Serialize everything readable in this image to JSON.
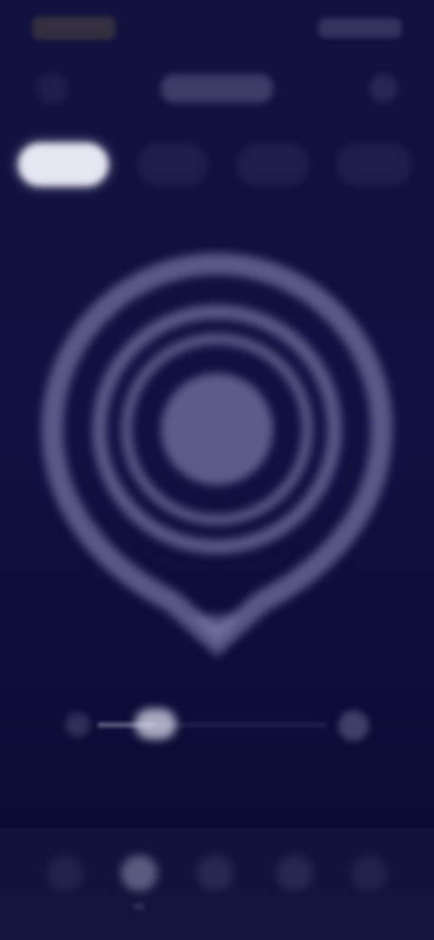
{
  "colors": {
    "background": "#101042",
    "accent": "#e6e6f2",
    "muted": "#8c8cbe"
  },
  "status_bar": {
    "time_icon": "clock-glyph",
    "right_icons": [
      "signal-icon",
      "wifi-icon",
      "battery-icon"
    ]
  },
  "header": {
    "back_icon": "chevron-left-icon",
    "menu_icon": "more-icon"
  },
  "tabs": {
    "active_index": 0,
    "items": [
      {
        "icon": "tab-icon",
        "active": true
      },
      {
        "icon": "tab-icon",
        "active": false
      },
      {
        "icon": "tab-icon",
        "active": false
      },
      {
        "icon": "tab-icon",
        "active": false
      }
    ]
  },
  "hero": {
    "icon": "location-pin-icon",
    "rings": 3
  },
  "slider": {
    "min_icon": "minus-icon",
    "max_icon": "plus-icon",
    "value": 0.25
  },
  "bottom_nav": {
    "active_index": 1,
    "items": [
      {
        "icon": "nav-icon-1"
      },
      {
        "icon": "nav-icon-2"
      },
      {
        "icon": "nav-icon-3"
      },
      {
        "icon": "nav-icon-4"
      },
      {
        "icon": "nav-icon-5"
      }
    ]
  }
}
